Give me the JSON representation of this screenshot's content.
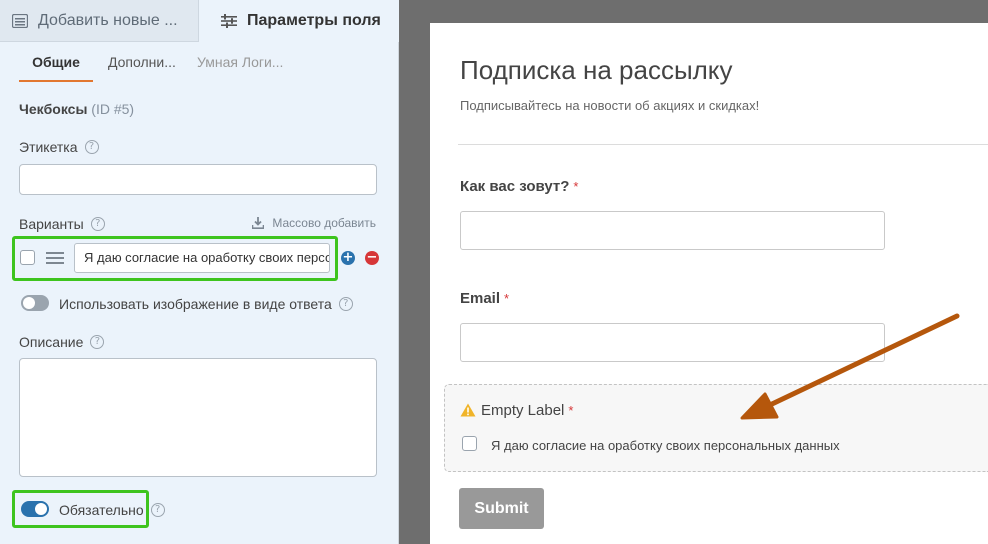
{
  "tabs": {
    "add_fields": "Добавить новые ...",
    "field_options": "Параметры поля"
  },
  "subtabs": {
    "general": "Общие",
    "advanced": "Дополни...",
    "smart_logic": "Умная Логи..."
  },
  "field": {
    "type_label": "Чекбоксы",
    "id_label": "(ID #5)"
  },
  "label_field": {
    "title": "Этикетка",
    "value": ""
  },
  "choices": {
    "title": "Варианты",
    "bulk_add": "Массово добавить",
    "items": [
      {
        "value": "Я даю согласие на оработку своих персональных данных",
        "checked": false
      }
    ]
  },
  "use_image_toggle": {
    "label": "Использовать изображение в виде ответа",
    "on": false
  },
  "description": {
    "title": "Описание",
    "value": ""
  },
  "required_toggle": {
    "label": "Обязательно",
    "on": true
  },
  "preview": {
    "title": "Подписка на рассылку",
    "description": "Подписывайтесь на новости об акциях и скидках!",
    "name_field": {
      "label": "Как вас зовут?",
      "required_mark": "*",
      "value": ""
    },
    "email_field": {
      "label": "Email",
      "required_mark": "*",
      "value": ""
    },
    "checkbox_field": {
      "label": "Empty Label",
      "required_mark": "*",
      "option": "Я даю согласие на оработку своих персональных данных"
    },
    "submit_label": "Submit"
  },
  "colors": {
    "panel_bg": "#ebf3fb",
    "highlight_green": "#3ec41e",
    "accent_orange": "#e27730",
    "arrow": "#b5570c",
    "toggle_on": "#2a72ad",
    "required_red": "#d63638",
    "submit_gray": "#999999"
  }
}
